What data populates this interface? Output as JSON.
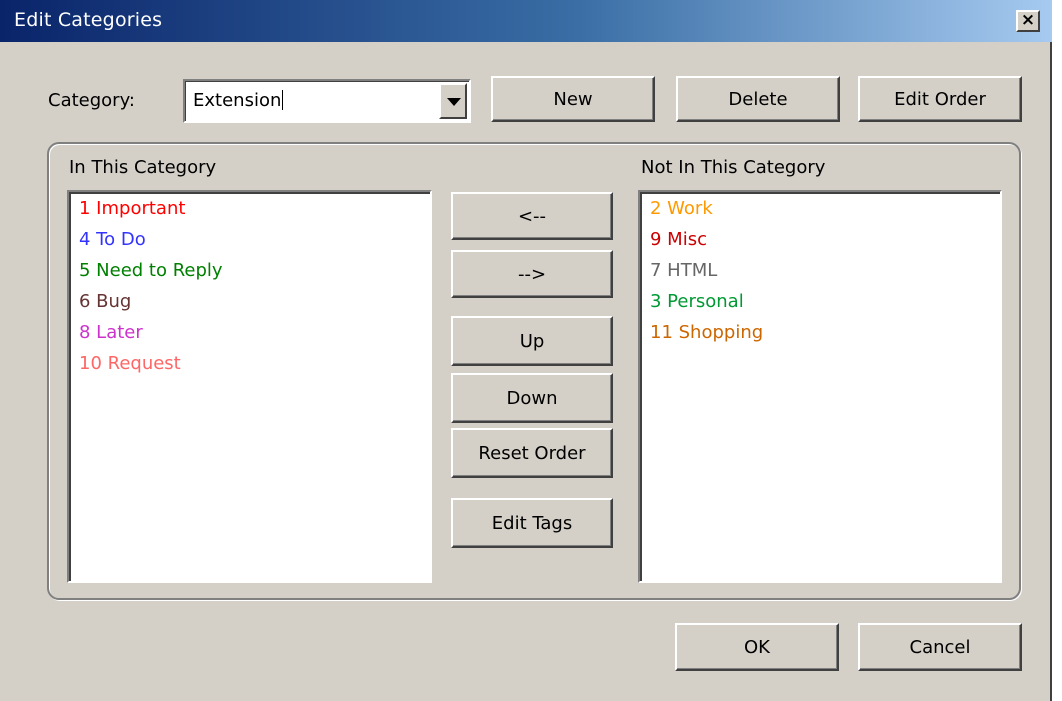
{
  "window": {
    "title": "Edit Categories",
    "close_label": "×"
  },
  "category": {
    "label": "Category:",
    "value": "Extension"
  },
  "top_buttons": {
    "new_label": "New",
    "delete_label": "Delete",
    "edit_order_label": "Edit Order"
  },
  "in_category": {
    "heading": "In This Category",
    "items": [
      {
        "text": "1 Important",
        "color": "#ff0000"
      },
      {
        "text": "4 To Do",
        "color": "#3333ff"
      },
      {
        "text": "5 Need to Reply",
        "color": "#008000"
      },
      {
        "text": "6 Bug",
        "color": "#663333"
      },
      {
        "text": "8 Later",
        "color": "#cc33cc"
      },
      {
        "text": "10 Request",
        "color": "#ff6666"
      }
    ]
  },
  "not_in_category": {
    "heading": "Not In This Category",
    "items": [
      {
        "text": "2 Work",
        "color": "#ff9900"
      },
      {
        "text": "9 Misc",
        "color": "#cc0000"
      },
      {
        "text": "7 HTML",
        "color": "#666666"
      },
      {
        "text": "3 Personal",
        "color": "#009933"
      },
      {
        "text": "11 Shopping",
        "color": "#cc6600"
      }
    ]
  },
  "middle_buttons": {
    "add_label": "<--",
    "remove_label": "-->",
    "up_label": "Up",
    "down_label": "Down",
    "reset_order_label": "Reset Order",
    "edit_tags_label": "Edit Tags"
  },
  "bottom_buttons": {
    "ok_label": "OK",
    "cancel_label": "Cancel"
  }
}
